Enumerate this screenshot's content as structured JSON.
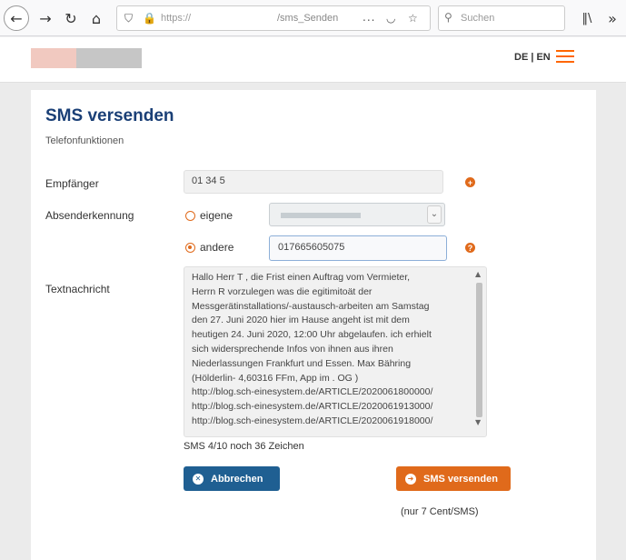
{
  "browser": {
    "url_prefix": "https://",
    "url_path": "/sms_Senden",
    "more_icon": "...",
    "search_placeholder": "Suchen"
  },
  "header": {
    "lang_switch": "DE | EN"
  },
  "main": {
    "title": "SMS versenden",
    "subtitle": "Telefonfunktionen",
    "recipient_label": "Empfänger",
    "recipient_value": "01 34       5",
    "sender_label": "Absenderkennung",
    "sender_own_label": "eigene",
    "sender_other_label": "andere",
    "sender_other_value": "017665605075",
    "message_label": "Textnachricht",
    "message_text": "Hallo Herr T      , die Frist einen Auftrag vom Vermieter,\nHerrn R        vorzulegen was die egitimitoät der\nMessgerätinstallations/-austausch-arbeiten am Samstag\nden 27. Juni 2020 hier im Hause angeht ist mit dem\nheutigen 24. Juni 2020, 12:00 Uhr abgelaufen. ich erhielt\nsich widersprechende Infos von ihnen aus ihren\nNiederlassungen Frankfurt und Essen. Max Bähring\n(Hölderlin- 4,60316 FFm, App         im     . OG         )\nhttp://blog.sch-einesystem.de/ARTICLE/2020061800000/\nhttp://blog.sch-einesystem.de/ARTICLE/2020061913000/\nhttp://blog.sch-einesystem.de/ARTICLE/2020061918000/",
    "counter_text": "SMS 4/10 noch 36 Zeichen",
    "cancel_label": "Abbrechen",
    "send_label": "SMS versenden",
    "price_note": "(nur 7 Cent/SMS)",
    "info_icon_glyph": "?",
    "plus_icon_glyph": "+"
  },
  "colors": {
    "brand_orange": "#e06a1b",
    "brand_blue": "#1f5f92",
    "title_blue": "#1a3f76"
  },
  "icons": [
    "back-icon",
    "forward-icon",
    "reload-icon",
    "home-icon",
    "shield-icon",
    "lock-icon",
    "pocket-icon",
    "star-icon",
    "search-icon",
    "library-icon",
    "overflow-icon",
    "hamburger-menu-icon",
    "info-icon",
    "question-icon",
    "close-icon",
    "arrow-right-icon"
  ]
}
